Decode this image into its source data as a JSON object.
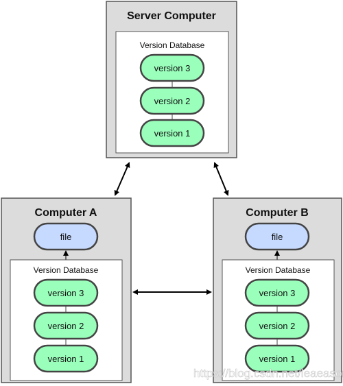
{
  "server": {
    "title": "Server Computer",
    "database_label": "Version Database",
    "versions": [
      "version 3",
      "version 2",
      "version 1"
    ]
  },
  "computer_a": {
    "title": "Computer A",
    "file_label": "file",
    "database_label": "Version Database",
    "versions": [
      "version 3",
      "version 2",
      "version 1"
    ]
  },
  "computer_b": {
    "title": "Computer B",
    "file_label": "file",
    "database_label": "Version Database",
    "versions": [
      "version 3",
      "version 2",
      "version 1"
    ]
  },
  "colors": {
    "version_fill": "#99ffbb",
    "file_fill": "#c6d9ff",
    "box_fill": "#dcdcdc"
  },
  "watermark": "https://blog.csdn.net/leaeason"
}
